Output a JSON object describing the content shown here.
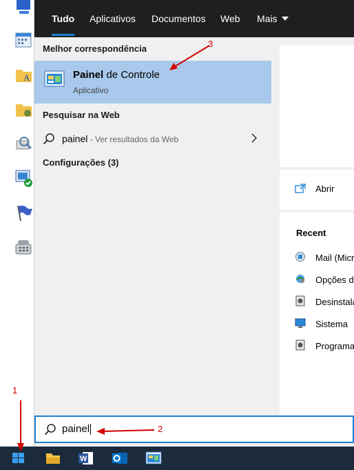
{
  "tabs": [
    {
      "label": "Tudo",
      "active": true
    },
    {
      "label": "Aplicativos"
    },
    {
      "label": "Documentos"
    },
    {
      "label": "Web"
    },
    {
      "label": "Mais"
    }
  ],
  "best_match": {
    "section": "Melhor correspondência",
    "title_bold": "Painel",
    "title_rest": " de Controle",
    "subtitle": "Aplicativo"
  },
  "web": {
    "section": "Pesquisar na Web",
    "query": "painel",
    "hint": " - Ver resultados da Web"
  },
  "settings": {
    "section": "Configurações (3)"
  },
  "right_pane": {
    "open_label": "Abrir",
    "recent_title": "Recent",
    "recent": [
      {
        "label": "Mail (Micr",
        "icon": "mail-settings-icon"
      },
      {
        "label": "Opções de",
        "icon": "internet-options-icon"
      },
      {
        "label": "Desinstala",
        "icon": "uninstall-icon"
      },
      {
        "label": "Sistema",
        "icon": "system-icon"
      },
      {
        "label": "Programa",
        "icon": "programs-icon"
      }
    ]
  },
  "search": {
    "value": "painel"
  },
  "annotations": {
    "n1": "1",
    "n2": "2",
    "n3": "3"
  },
  "colors": {
    "accent": "#1c7fd6",
    "highlight": "#a9c9ec",
    "annotation": "#d40000",
    "tabbar": "#1f1f1f",
    "taskbar": "#1b2b3c"
  }
}
